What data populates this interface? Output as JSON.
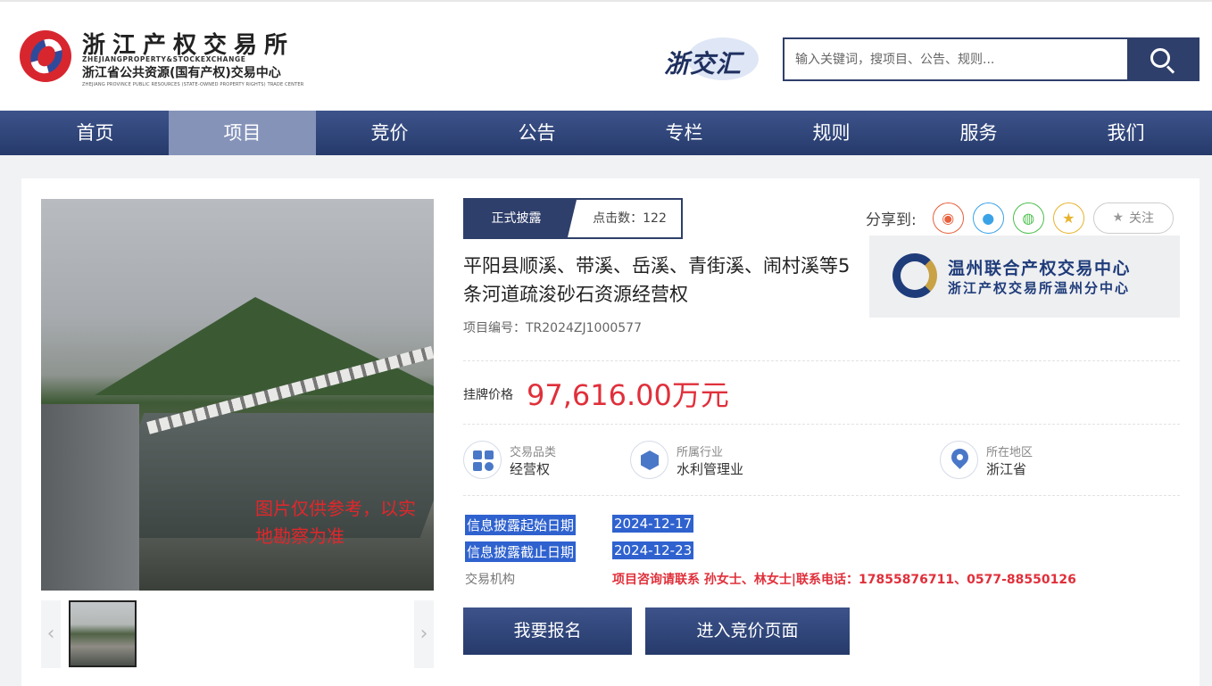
{
  "header": {
    "logo": {
      "title": "浙江产权交易所",
      "subtitle_en": "ZHEJIANGPROPERTY&STOCKEXCHANGE",
      "subtitle_cn": "浙江省公共资源(国有产权)交易中心",
      "subtitle_en_small": "ZHEJIANG PROVINCE PUBLIC RESOURCES (STATE-OWNED PROPERTY RIGHTS) TRADE CENTER"
    },
    "brand_mark": "浙交汇",
    "search": {
      "placeholder": "输入关键词，搜项目、公告、规则..."
    }
  },
  "nav": {
    "items": [
      {
        "label": "首页",
        "active": false
      },
      {
        "label": "项目",
        "active": true
      },
      {
        "label": "竞价",
        "active": false
      },
      {
        "label": "公告",
        "active": false
      },
      {
        "label": "专栏",
        "active": false
      },
      {
        "label": "规则",
        "active": false
      },
      {
        "label": "服务",
        "active": false
      },
      {
        "label": "我们",
        "active": false
      }
    ]
  },
  "project": {
    "image_note": "图片仅供参考，以实地勘察为准",
    "status_tag": "正式披露",
    "clicks_label": "点击数：",
    "clicks": "122",
    "share_label": "分享到:",
    "follow_label": "关注",
    "title": "平阳县顺溪、带溪、岳溪、青街溪、闹村溪等5条河道疏浚砂石资源经营权",
    "project_no_label": "项目编号：",
    "project_no": "TR2024ZJ1000577",
    "org": {
      "name": "温州联合产权交易中心",
      "sub": "浙江产权交易所温州分中心"
    },
    "price_label": "挂牌价格",
    "price": "97,616.00万元",
    "attributes": [
      {
        "label": "交易品类",
        "value": "经营权",
        "icon": "grid-icon"
      },
      {
        "label": "所属行业",
        "value": "水利管理业",
        "icon": "cube-icon"
      },
      {
        "label": "所在地区",
        "value": "浙江省",
        "icon": "location-pin-icon"
      }
    ],
    "dates": [
      {
        "label": "信息披露起始日期",
        "value": "2024-12-17"
      },
      {
        "label": "信息披露截止日期",
        "value": "2024-12-23"
      }
    ],
    "agency_label": "交易机构",
    "agency_value": "项目咨询请联系 孙女士、林女士|联系电话：17855876711、0577-88550126",
    "buttons": {
      "register": "我要报名",
      "auction": "进入竞价页面"
    }
  },
  "colors": {
    "primary": "#2f3f6b",
    "price": "#e0303b",
    "highlight": "#2f62cf"
  }
}
